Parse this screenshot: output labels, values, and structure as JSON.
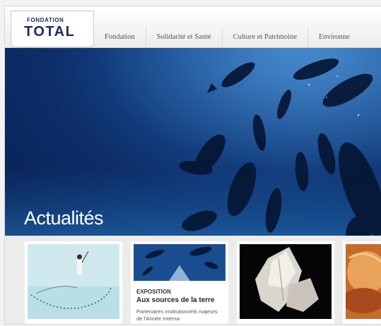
{
  "logo": {
    "small": "FONDATION",
    "big": "TOTAL"
  },
  "nav": [
    "Fondation",
    "Solidarité et Santé",
    "Culture et Patrimoine",
    "Environne"
  ],
  "hero": {
    "title": "Actualités"
  },
  "cards": [
    {
      "category": "",
      "title": "",
      "description": ""
    },
    {
      "category": "EXPOSITION",
      "title": "Aux sources de la terre",
      "description": "Partenaires institutionnels majeurs de l'Année Interna-"
    },
    {
      "category": "",
      "title": "",
      "description": ""
    },
    {
      "category": "",
      "title": "",
      "description": ""
    }
  ],
  "colors": {
    "brand": "#1c2a6b",
    "hero_blue": "#0d2e6a"
  }
}
